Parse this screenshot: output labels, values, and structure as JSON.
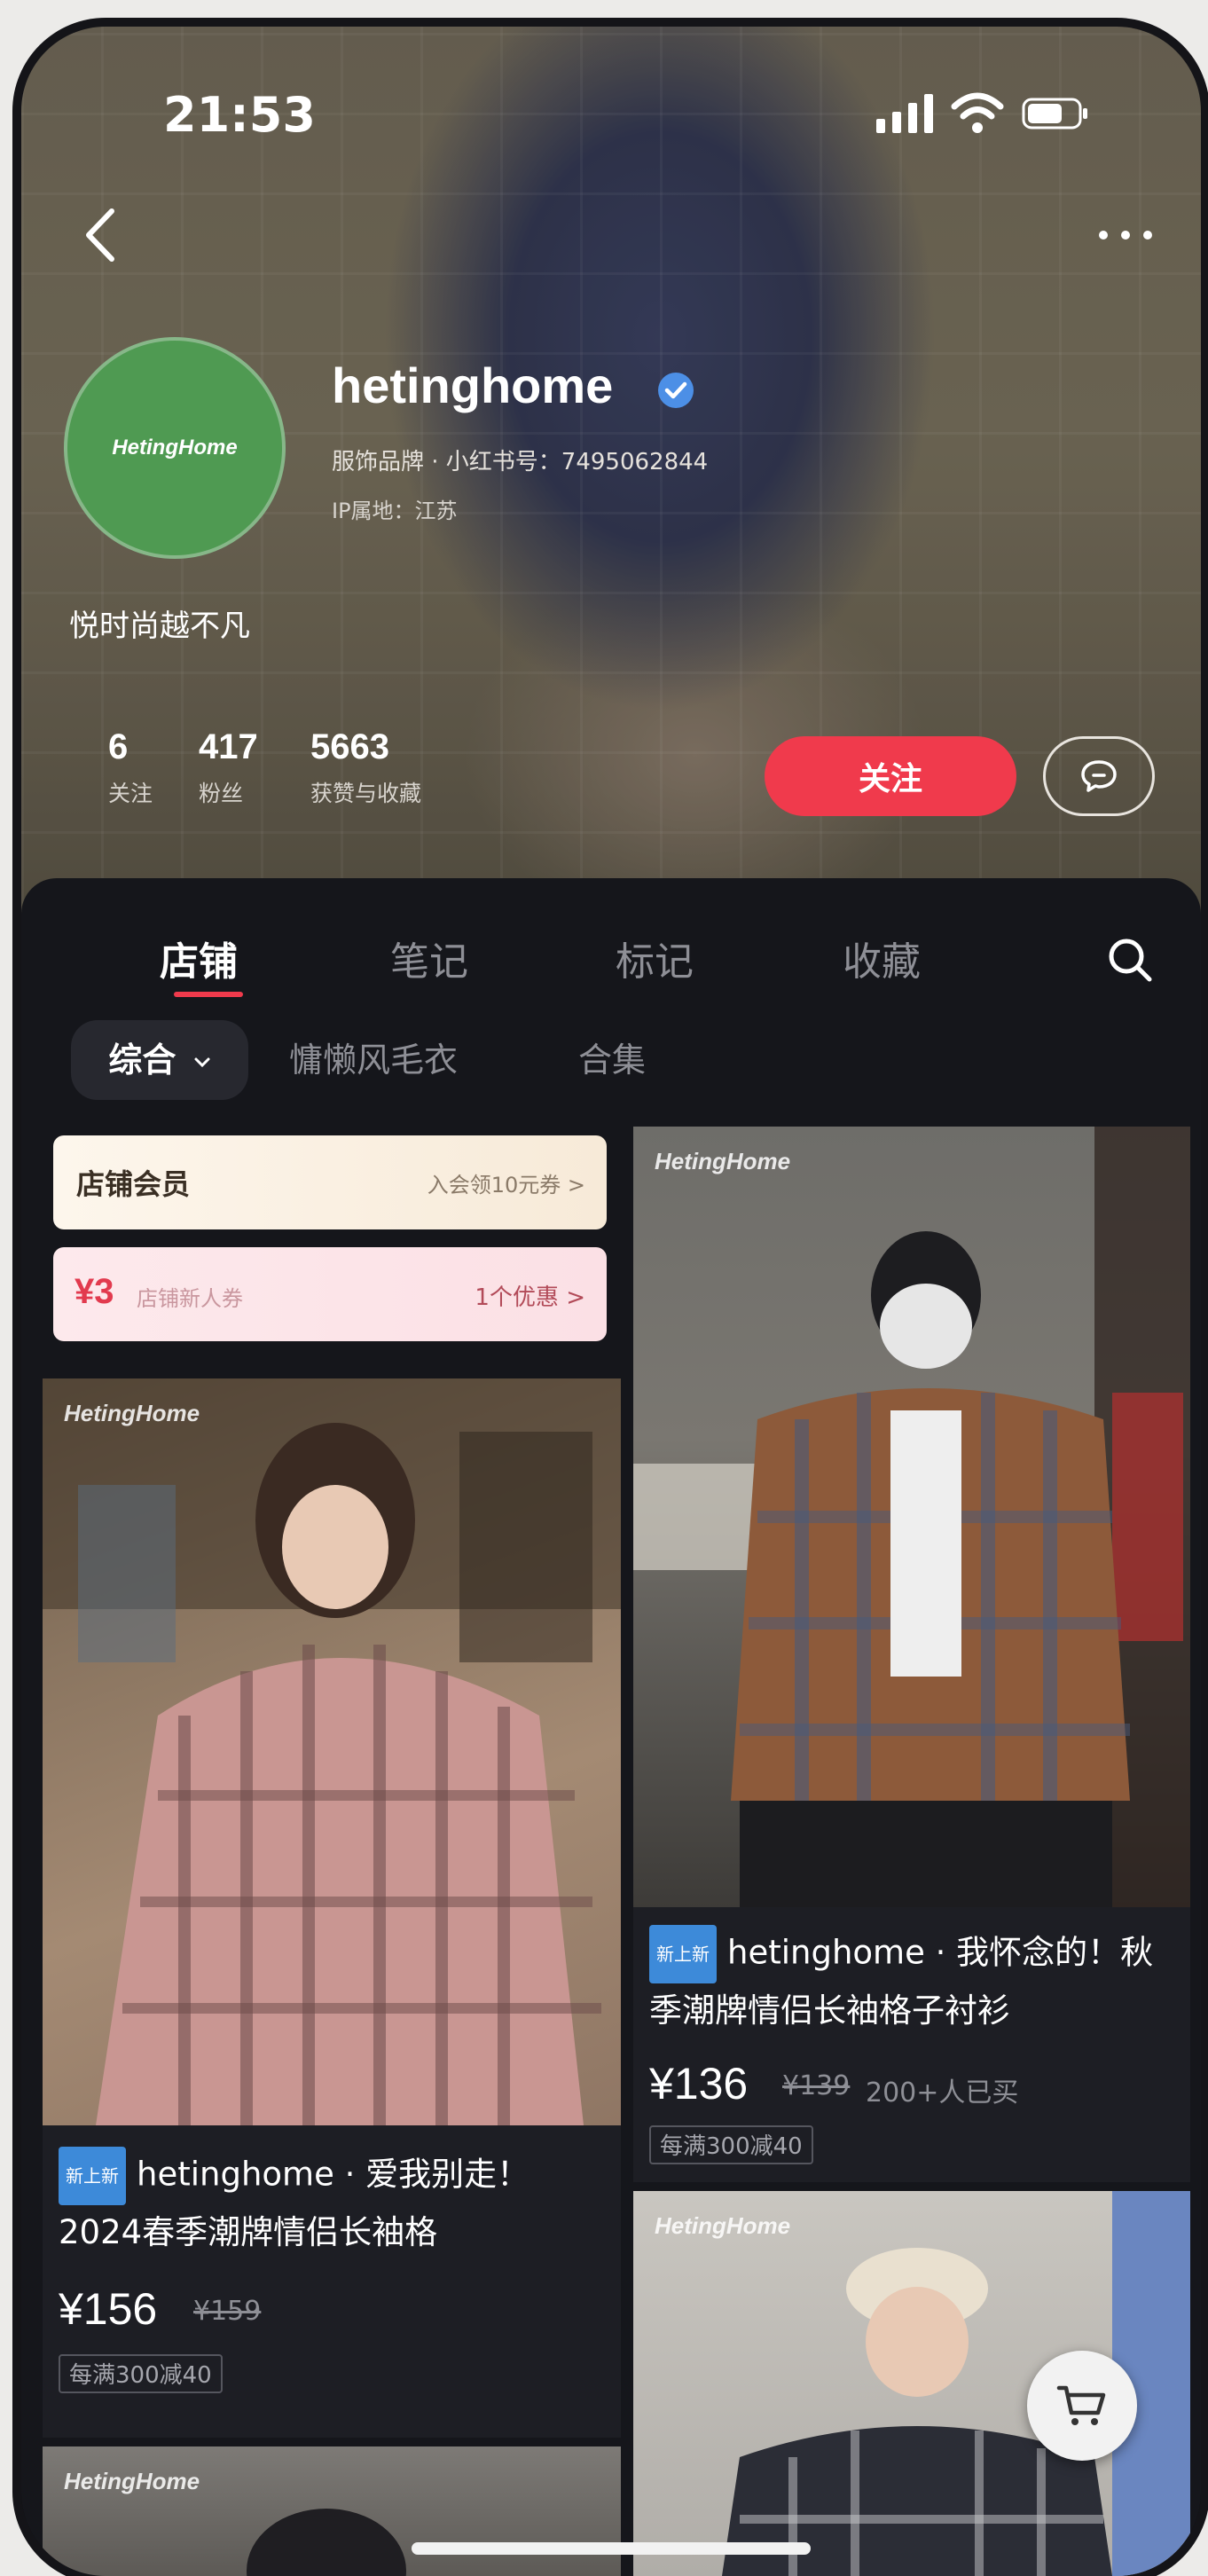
{
  "status": {
    "time": "21:53"
  },
  "profile": {
    "username": "hetinghome",
    "avatar_text": "HetingHome",
    "meta_line": "服饰品牌 · 小红书号：7495062844",
    "ip_line": "IP属地：江苏",
    "bio": "悦时尚越不凡"
  },
  "stats": [
    {
      "num": "6",
      "label": "关注"
    },
    {
      "num": "417",
      "label": "粉丝"
    },
    {
      "num": "5663",
      "label": "获赞与收藏"
    }
  ],
  "actions": {
    "follow": "关注"
  },
  "tabs": [
    {
      "label": "店铺"
    },
    {
      "label": "笔记"
    },
    {
      "label": "标记"
    },
    {
      "label": "收藏"
    }
  ],
  "filters": [
    {
      "label": "综合"
    },
    {
      "label": "慵懒风毛衣"
    },
    {
      "label": "合集"
    }
  ],
  "store": {
    "member": {
      "title": "店铺会员",
      "link": "入会领10元券 >"
    },
    "coupon": {
      "amount": "¥3",
      "title": "店铺新人券",
      "link": "1个优惠 >"
    }
  },
  "watermark": "HetingHome",
  "products": [
    {
      "tag": "新上新",
      "title": "hetinghome · 我怀念的！秋季潮牌情侣长袖格子衬衫",
      "price": "¥136",
      "old_price": "¥139",
      "sold": "200+人已买",
      "promo": "每满300减40"
    },
    {
      "tag": "新上新",
      "title": "hetinghome · 爱我别走！2024春季潮牌情侣长袖格",
      "price": "¥156",
      "old_price": "¥159",
      "sold": "",
      "promo": "每满300减40"
    }
  ],
  "icons": {
    "back": "chevron-left-icon",
    "more": "more-dots-icon",
    "verified": "verified-badge-icon",
    "message": "chat-bubble-icon",
    "search": "search-icon",
    "cart": "cart-icon"
  },
  "colors": {
    "accent": "#f03a4c",
    "avatar": "#4f9a52",
    "tag": "#3d8ad9"
  }
}
